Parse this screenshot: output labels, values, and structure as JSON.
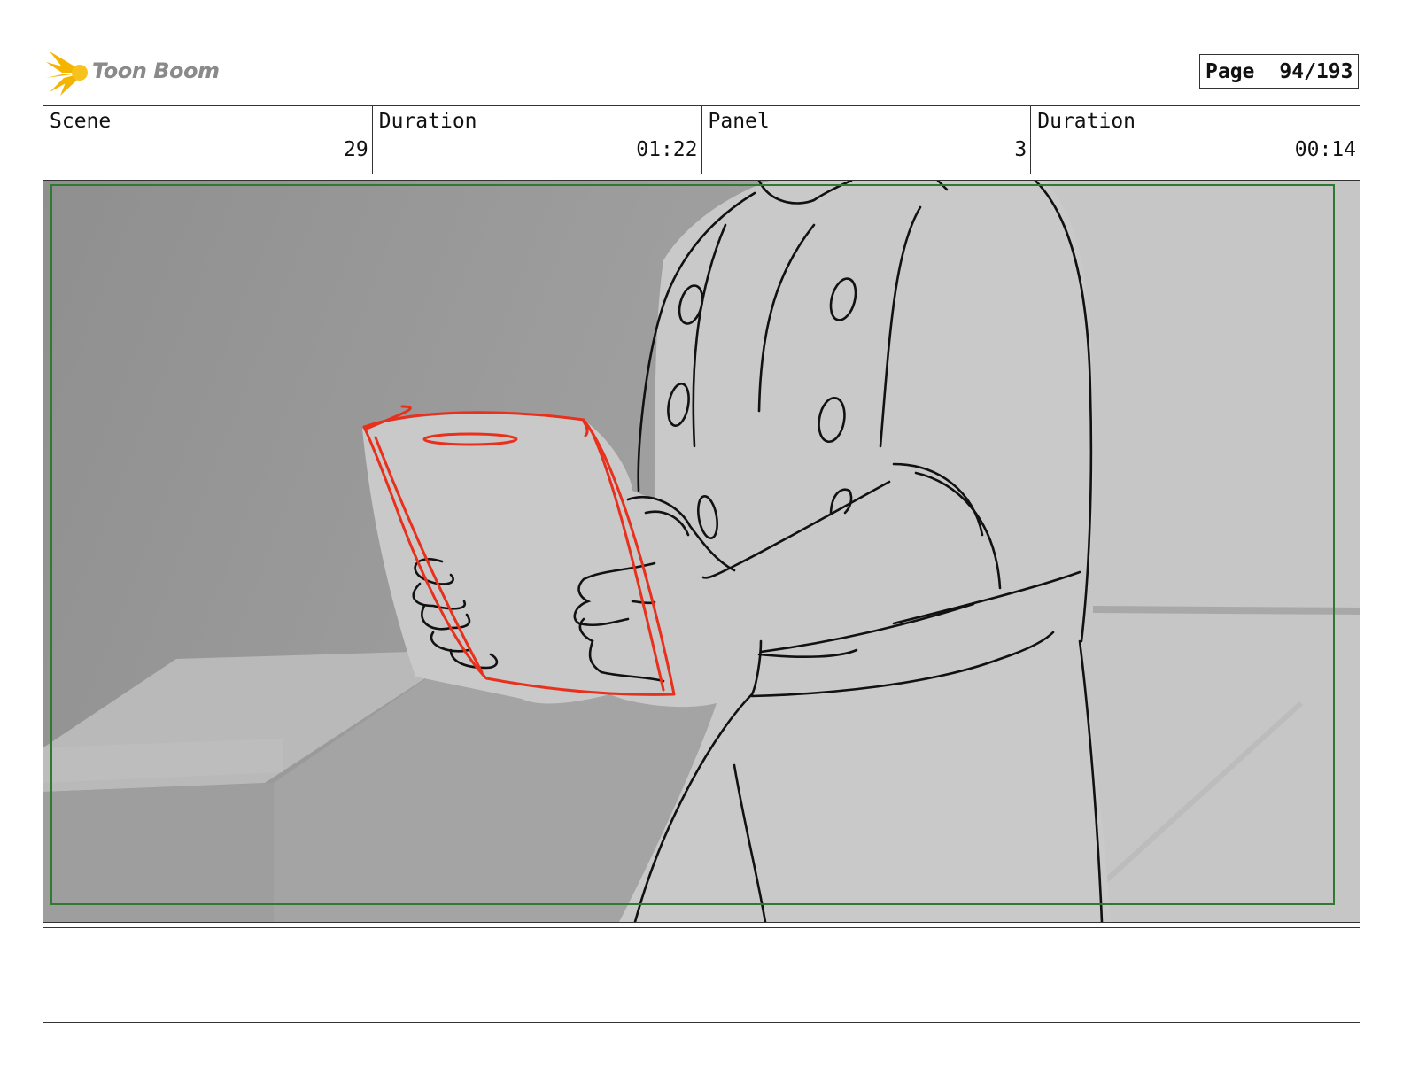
{
  "header": {
    "logo_text": "Toon Boom",
    "page_label": "Page",
    "page_number": "94/193"
  },
  "info": {
    "scene_label": "Scene",
    "scene_value": "29",
    "scene_duration_label": "Duration",
    "scene_duration_value": "01:22",
    "panel_label": "Panel",
    "panel_value": "3",
    "panel_duration_label": "Duration",
    "panel_duration_value": "00:14"
  },
  "panel_image": {
    "icon": "storyboard-sketch-image",
    "colors": {
      "sketch_line": "#111111",
      "highlight_line": "#e8301c",
      "safe_area": "#2f7a2f"
    }
  },
  "notes": {
    "text": ""
  }
}
